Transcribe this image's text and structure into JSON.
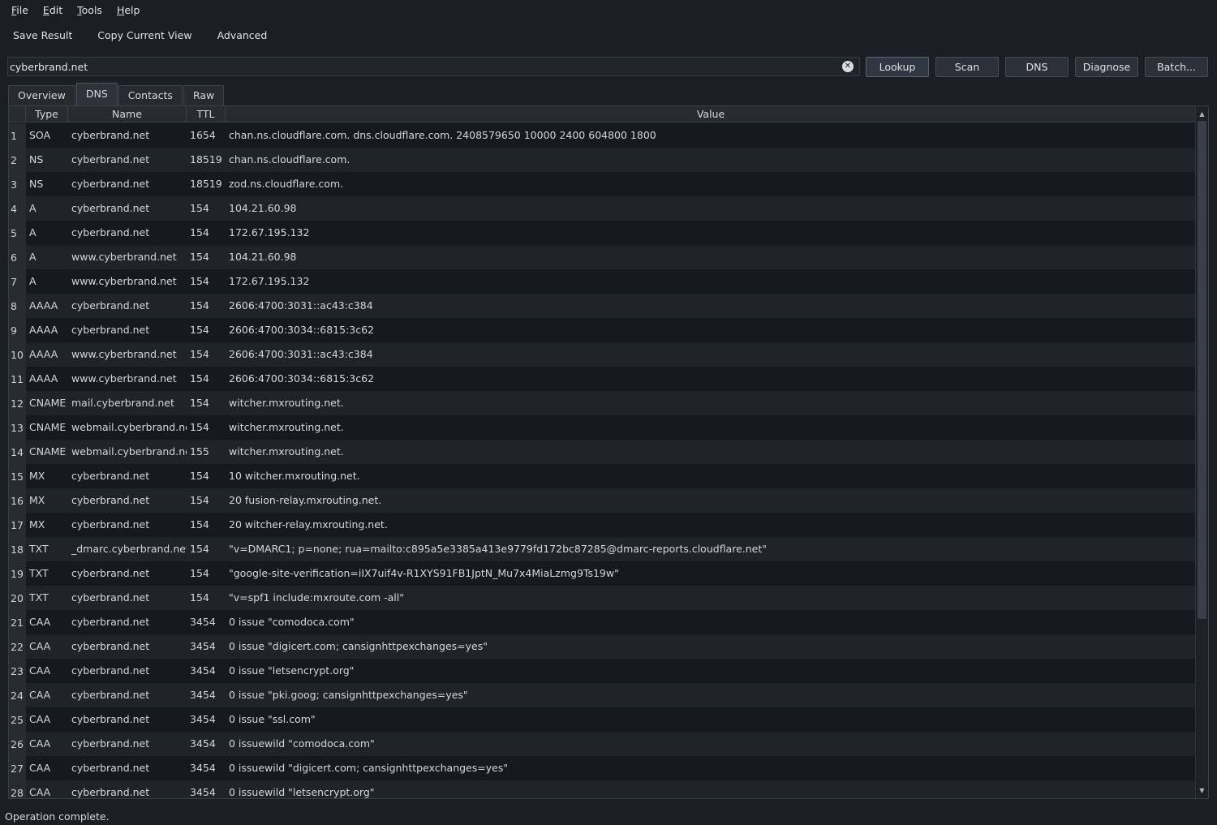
{
  "menu": [
    "File",
    "Edit",
    "Tools",
    "Help"
  ],
  "toolbar": {
    "save": "Save Result",
    "copy": "Copy Current View",
    "advanced": "Advanced"
  },
  "search": {
    "value": "cyberbrand.net"
  },
  "actions": {
    "lookup": "Lookup",
    "scan": "Scan",
    "dns": "DNS",
    "diagnose": "Diagnose",
    "batch": "Batch..."
  },
  "tabs": [
    "Overview",
    "DNS",
    "Contacts",
    "Raw"
  ],
  "active_tab": "DNS",
  "table": {
    "headers": {
      "type": "Type",
      "name": "Name",
      "ttl": "TTL",
      "value": "Value"
    },
    "rows": [
      {
        "n": "1",
        "type": "SOA",
        "name": "cyberbrand.net",
        "ttl": "1654",
        "value": "chan.ns.cloudflare.com. dns.cloudflare.com. 2408579650 10000 2400 604800 1800"
      },
      {
        "n": "2",
        "type": "NS",
        "name": "cyberbrand.net",
        "ttl": "18519",
        "value": "chan.ns.cloudflare.com."
      },
      {
        "n": "3",
        "type": "NS",
        "name": "cyberbrand.net",
        "ttl": "18519",
        "value": "zod.ns.cloudflare.com."
      },
      {
        "n": "4",
        "type": "A",
        "name": "cyberbrand.net",
        "ttl": "154",
        "value": "104.21.60.98"
      },
      {
        "n": "5",
        "type": "A",
        "name": "cyberbrand.net",
        "ttl": "154",
        "value": "172.67.195.132"
      },
      {
        "n": "6",
        "type": "A",
        "name": "www.cyberbrand.net",
        "ttl": "154",
        "value": "104.21.60.98"
      },
      {
        "n": "7",
        "type": "A",
        "name": "www.cyberbrand.net",
        "ttl": "154",
        "value": "172.67.195.132"
      },
      {
        "n": "8",
        "type": "AAAA",
        "name": "cyberbrand.net",
        "ttl": "154",
        "value": "2606:4700:3031::ac43:c384"
      },
      {
        "n": "9",
        "type": "AAAA",
        "name": "cyberbrand.net",
        "ttl": "154",
        "value": "2606:4700:3034::6815:3c62"
      },
      {
        "n": "10",
        "type": "AAAA",
        "name": "www.cyberbrand.net",
        "ttl": "154",
        "value": "2606:4700:3031::ac43:c384"
      },
      {
        "n": "11",
        "type": "AAAA",
        "name": "www.cyberbrand.net",
        "ttl": "154",
        "value": "2606:4700:3034::6815:3c62"
      },
      {
        "n": "12",
        "type": "CNAME",
        "name": "mail.cyberbrand.net",
        "ttl": "154",
        "value": "witcher.mxrouting.net."
      },
      {
        "n": "13",
        "type": "CNAME",
        "name": "webmail.cyberbrand.net",
        "ttl": "154",
        "value": "witcher.mxrouting.net."
      },
      {
        "n": "14",
        "type": "CNAME",
        "name": "webmail.cyberbrand.net",
        "ttl": "155",
        "value": "witcher.mxrouting.net."
      },
      {
        "n": "15",
        "type": "MX",
        "name": "cyberbrand.net",
        "ttl": "154",
        "value": "10 witcher.mxrouting.net."
      },
      {
        "n": "16",
        "type": "MX",
        "name": "cyberbrand.net",
        "ttl": "154",
        "value": "20 fusion-relay.mxrouting.net."
      },
      {
        "n": "17",
        "type": "MX",
        "name": "cyberbrand.net",
        "ttl": "154",
        "value": "20 witcher-relay.mxrouting.net."
      },
      {
        "n": "18",
        "type": "TXT",
        "name": "_dmarc.cyberbrand.net",
        "ttl": "154",
        "value": "\"v=DMARC1; p=none; rua=mailto:c895a5e3385a413e9779fd172bc87285@dmarc-reports.cloudflare.net\""
      },
      {
        "n": "19",
        "type": "TXT",
        "name": "cyberbrand.net",
        "ttl": "154",
        "value": "\"google-site-verification=iIX7uif4v-R1XYS91FB1JptN_Mu7x4MiaLzmg9Ts19w\""
      },
      {
        "n": "20",
        "type": "TXT",
        "name": "cyberbrand.net",
        "ttl": "154",
        "value": "\"v=spf1 include:mxroute.com -all\""
      },
      {
        "n": "21",
        "type": "CAA",
        "name": "cyberbrand.net",
        "ttl": "3454",
        "value": "0 issue \"comodoca.com\""
      },
      {
        "n": "22",
        "type": "CAA",
        "name": "cyberbrand.net",
        "ttl": "3454",
        "value": "0 issue \"digicert.com; cansignhttpexchanges=yes\""
      },
      {
        "n": "23",
        "type": "CAA",
        "name": "cyberbrand.net",
        "ttl": "3454",
        "value": "0 issue \"letsencrypt.org\""
      },
      {
        "n": "24",
        "type": "CAA",
        "name": "cyberbrand.net",
        "ttl": "3454",
        "value": "0 issue \"pki.goog; cansignhttpexchanges=yes\""
      },
      {
        "n": "25",
        "type": "CAA",
        "name": "cyberbrand.net",
        "ttl": "3454",
        "value": "0 issue \"ssl.com\""
      },
      {
        "n": "26",
        "type": "CAA",
        "name": "cyberbrand.net",
        "ttl": "3454",
        "value": "0 issuewild \"comodoca.com\""
      },
      {
        "n": "27",
        "type": "CAA",
        "name": "cyberbrand.net",
        "ttl": "3454",
        "value": "0 issuewild \"digicert.com; cansignhttpexchanges=yes\""
      },
      {
        "n": "28",
        "type": "CAA",
        "name": "cyberbrand.net",
        "ttl": "3454",
        "value": "0 issuewild \"letsencrypt.org\""
      }
    ]
  },
  "status": "Operation complete.",
  "colors": {
    "background": "#1b1e24",
    "row_alt": "#1f242b",
    "header": "#272b32"
  }
}
